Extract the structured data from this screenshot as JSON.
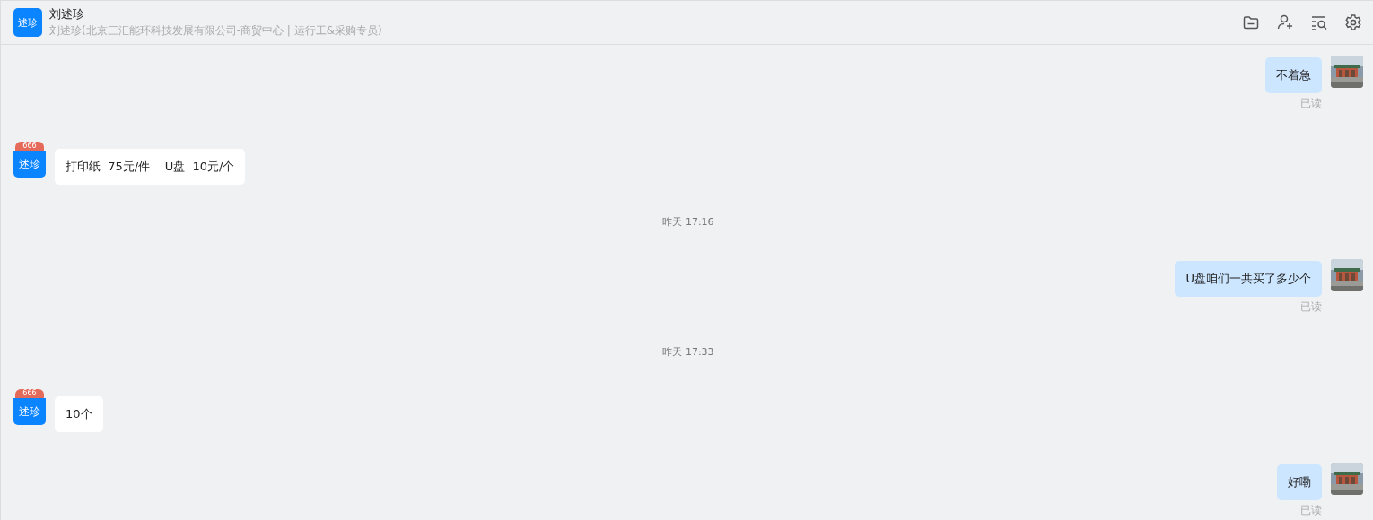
{
  "header": {
    "avatar_text": "述珍",
    "name": "刘述珍",
    "subtitle": "刘述珍(北京三汇能环科技发展有限公司-商贸中心 | 运行工&采购专员)"
  },
  "messages": [
    {
      "kind": "sent",
      "text": "不着急",
      "status": "已读"
    },
    {
      "kind": "received",
      "avatar_text": "述珍",
      "avatar_badge": "666",
      "text": "打印纸  75元/件    U盘  10元/个"
    },
    {
      "kind": "time",
      "text": "昨天 17:16"
    },
    {
      "kind": "sent",
      "text": "U盘咱们一共买了多少个",
      "status": "已读"
    },
    {
      "kind": "time",
      "text": "昨天 17:33"
    },
    {
      "kind": "received",
      "avatar_text": "述珍",
      "avatar_badge": "666",
      "text": "10个"
    },
    {
      "kind": "sent",
      "text": "好嘞",
      "status": "已读"
    }
  ]
}
